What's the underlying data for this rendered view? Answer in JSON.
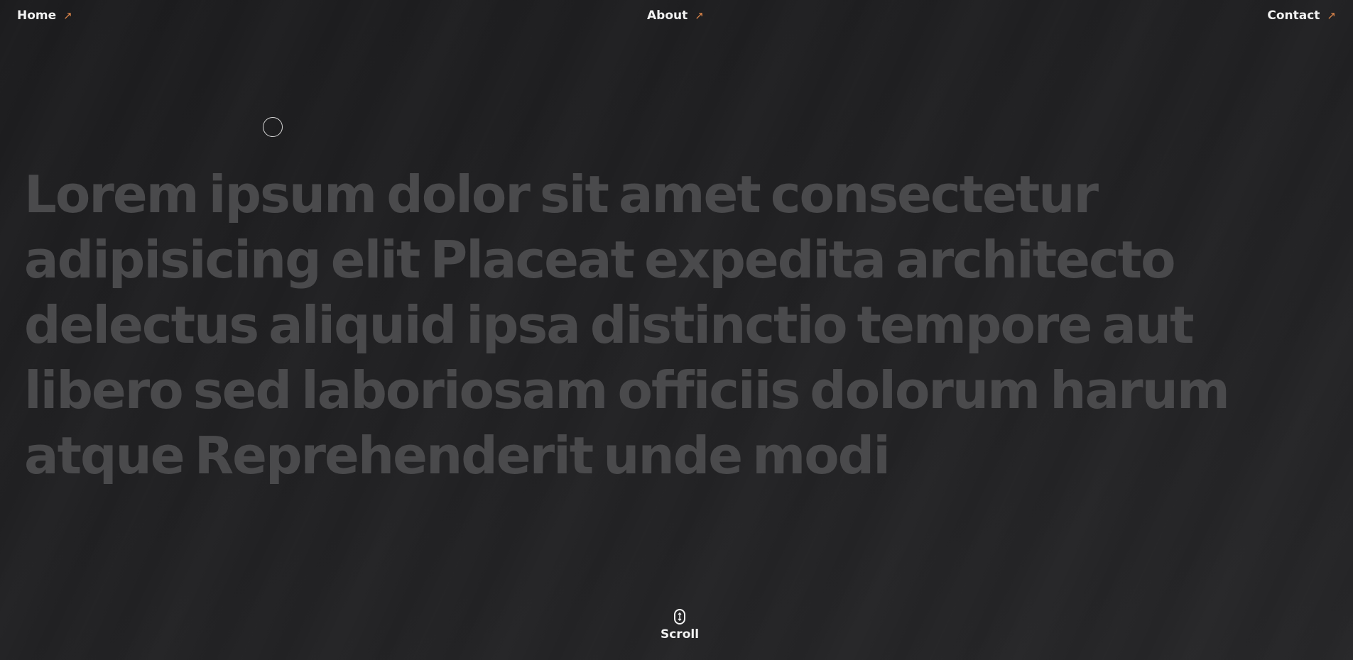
{
  "nav": {
    "home": {
      "label": "Home",
      "icon": "arrow-up-right-icon"
    },
    "about": {
      "label": "About",
      "icon": "arrow-up-right-icon"
    },
    "contact": {
      "label": "Contact",
      "icon": "arrow-up-right-icon"
    },
    "accent_color": "#e0874a"
  },
  "hero": {
    "text": "Lorem ipsum dolor sit amet consectetur adipisicing elit Placeat expedita architecto delectus aliquid ipsa distinctio tempore aut libero sed laboriosam officiis dolorum harum atque Reprehenderit unde modi"
  },
  "scroll": {
    "label": "Scroll",
    "icon": "mouse-scroll-icon"
  },
  "colors": {
    "background": "#1e1e20",
    "hero_text": "#4a4a4c",
    "nav_text": "#f2f2f2"
  }
}
